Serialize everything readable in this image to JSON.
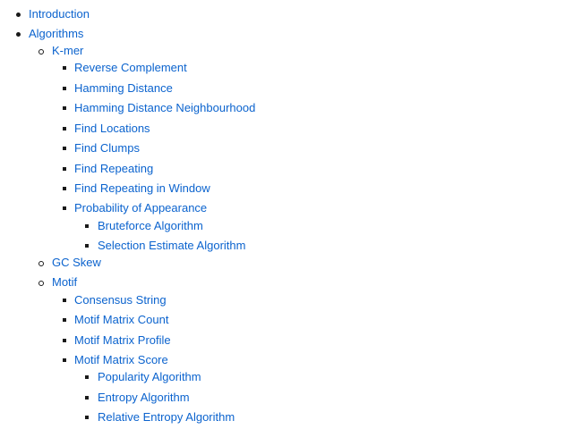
{
  "toc": {
    "introduction": "Introduction",
    "algorithms": "Algorithms",
    "kmer": {
      "label": "K-mer",
      "items": {
        "reverse_complement": "Reverse Complement",
        "hamming_distance": "Hamming Distance",
        "hamming_distance_neighbourhood": "Hamming Distance Neighbourhood",
        "find_locations": "Find Locations",
        "find_clumps": "Find Clumps",
        "find_repeating": "Find Repeating",
        "find_repeating_in_window": "Find Repeating in Window",
        "probability_of_appearance": "Probability of Appearance",
        "bruteforce_algorithm": "Bruteforce Algorithm",
        "selection_estimate_algorithm": "Selection Estimate Algorithm"
      }
    },
    "gc_skew": "GC Skew",
    "motif": {
      "label": "Motif",
      "items": {
        "consensus_string": "Consensus String",
        "motif_matrix_count": "Motif Matrix Count",
        "motif_matrix_profile": "Motif Matrix Profile",
        "motif_matrix_score": "Motif Matrix Score",
        "popularity_algorithm": "Popularity Algorithm",
        "entropy_algorithm": "Entropy Algorithm",
        "relative_entropy_algorithm": "Relative Entropy Algorithm"
      }
    }
  }
}
